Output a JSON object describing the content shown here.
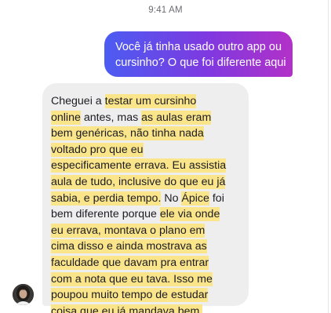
{
  "status": {
    "time": "9:41 AM"
  },
  "outgoing": {
    "lines": [
      "Você já tinha usado outro app ou",
      "cursinho? O que foi diferente aqui"
    ]
  },
  "incoming": {
    "lines": [
      [
        {
          "t": "Cheguei a ",
          "h": false
        },
        {
          "t": "testar um cursinho",
          "h": true
        }
      ],
      [
        {
          "t": "online",
          "h": true
        },
        {
          "t": " antes, mas ",
          "h": false
        },
        {
          "t": "as aulas eram",
          "h": true
        }
      ],
      [
        {
          "t": "bem genéricas, não tinha nada",
          "h": true
        }
      ],
      [
        {
          "t": "voltado pro que eu",
          "h": true
        }
      ],
      [
        {
          "t": "especificamente errava. Eu assistia",
          "h": true
        }
      ],
      [
        {
          "t": "aula de tudo, inclusive do que eu já",
          "h": true
        }
      ],
      [
        {
          "t": "sabia, e perdia tempo.",
          "h": true
        },
        {
          "t": " No ",
          "h": false
        },
        {
          "t": "Ápice",
          "h": true
        },
        {
          "t": " foi",
          "h": false
        }
      ],
      [
        {
          "t": "bem diferente porque ",
          "h": false
        },
        {
          "t": "ele via onde",
          "h": true
        }
      ],
      [
        {
          "t": "eu errava, montava o plano em",
          "h": true
        }
      ],
      [
        {
          "t": "cima disso e ainda mostrava as",
          "h": true
        }
      ],
      [
        {
          "t": "faculdade que davam pra entrar",
          "h": true
        }
      ],
      [
        {
          "t": "com a nota que eu tava. Isso me",
          "h": true
        }
      ],
      [
        {
          "t": "poupou muito tempo de estudar",
          "h": true
        }
      ],
      [
        {
          "t": "coisa que eu já mandava bem.",
          "h": true
        }
      ]
    ]
  },
  "colors": {
    "highlight": "#fbe58b",
    "outgoing_gradient": [
      "#4b5cf2",
      "#b231c8"
    ],
    "incoming_bg": "#eeeeef"
  }
}
